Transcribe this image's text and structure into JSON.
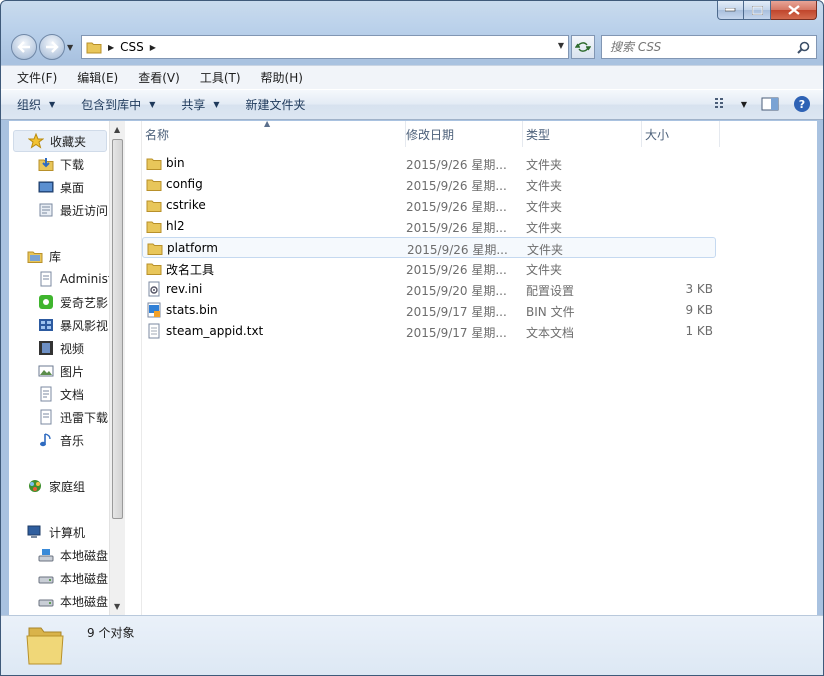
{
  "address": {
    "path": "CSS"
  },
  "search": {
    "placeholder": "搜索 CSS"
  },
  "menu": [
    "文件(F)",
    "编辑(E)",
    "查看(V)",
    "工具(T)",
    "帮助(H)"
  ],
  "commands": {
    "organize": "组织",
    "include": "包含到库中",
    "share": "共享",
    "new_folder": "新建文件夹"
  },
  "sidebar": {
    "favorites": "收藏夹",
    "fav_items": [
      "下载",
      "桌面",
      "最近访问"
    ],
    "libraries": "库",
    "lib_items": [
      "Administ",
      "爱奇艺影",
      "暴风影视",
      "视频",
      "图片",
      "文档",
      "迅雷下载",
      "音乐"
    ],
    "homegroup": "家庭组",
    "computer": "计算机",
    "drives": [
      "本地磁盘",
      "本地磁盘",
      "本地磁盘"
    ]
  },
  "columns": {
    "name": "名称",
    "date": "修改日期",
    "type": "类型",
    "size": "大小"
  },
  "files": [
    {
      "name": "bin",
      "date": "2015/9/26 星期...",
      "type": "文件夹",
      "size": "",
      "icon": "folder-icon"
    },
    {
      "name": "config",
      "date": "2015/9/26 星期...",
      "type": "文件夹",
      "size": "",
      "icon": "folder-icon"
    },
    {
      "name": "cstrike",
      "date": "2015/9/26 星期...",
      "type": "文件夹",
      "size": "",
      "icon": "folder-icon"
    },
    {
      "name": "hl2",
      "date": "2015/9/26 星期...",
      "type": "文件夹",
      "size": "",
      "icon": "folder-icon"
    },
    {
      "name": "platform",
      "date": "2015/9/26 星期...",
      "type": "文件夹",
      "size": "",
      "icon": "folder-icon"
    },
    {
      "name": "改名工具",
      "date": "2015/9/26 星期...",
      "type": "文件夹",
      "size": "",
      "icon": "folder-icon"
    },
    {
      "name": "rev.ini",
      "date": "2015/9/20 星期...",
      "type": "配置设置",
      "size": "3 KB",
      "icon": "settings-file-icon"
    },
    {
      "name": "stats.bin",
      "date": "2015/9/17 星期...",
      "type": "BIN 文件",
      "size": "9 KB",
      "icon": "bin-file-icon"
    },
    {
      "name": "steam_appid.txt",
      "date": "2015/9/17 星期...",
      "type": "文本文档",
      "size": "1 KB",
      "icon": "text-file-icon"
    }
  ],
  "status": {
    "count": "9 个对象"
  },
  "colors": {
    "folder": "#e8c65a",
    "selection_border": "#c5d9f0",
    "header_text": "#4c607a"
  }
}
